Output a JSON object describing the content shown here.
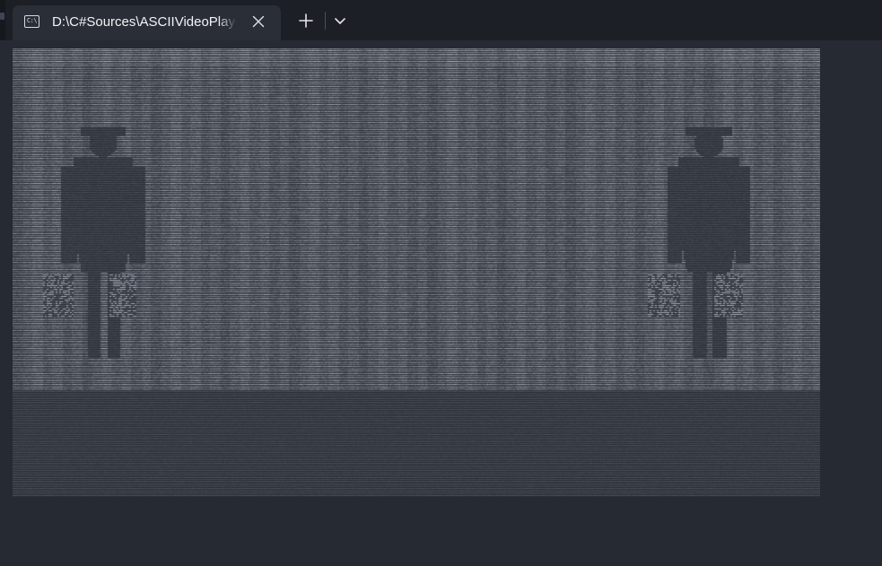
{
  "tab": {
    "title": "D:\\C#Sources\\ASCIIVideoPlayer",
    "icon": "console-icon",
    "icon_glyph": "C:\\"
  },
  "tabbar": {
    "new_tab_icon": "plus-icon",
    "dropdown_icon": "chevron-down-icon"
  },
  "terminal": {
    "content": "ascii-video-frame"
  },
  "colors": {
    "tabbar_bg": "#1c1f25",
    "tab_bg": "#2a2e36",
    "terminal_bg": "#262a33",
    "ascii_bright": "#c7ccd6",
    "ascii_dark": "#2c3038"
  }
}
